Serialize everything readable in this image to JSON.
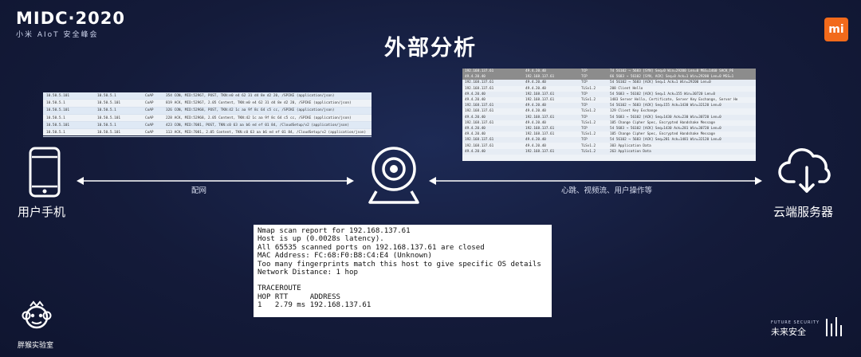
{
  "header": {
    "brand_title": "MIDC·2020",
    "brand_subtitle": "小米 AIoT 安全峰会",
    "mi_logo": "mi",
    "slide_title": "外部分析"
  },
  "left_capture": {
    "rows": [
      {
        "src": "10.50.5.101",
        "dst": "10.50.5.1",
        "proto": "CoAP",
        "info": "354 CON, MID:52967, POST, TKN:e0 e4 62 31 d4 8e d2 20, /SPIKE (application/json)"
      },
      {
        "src": "10.50.5.1",
        "dst": "10.50.5.101",
        "proto": "CoAP",
        "info": "819 ACK, MID:52967, 2.05 Content, TKN:e0 e4 62 31 d4 8e d2 20, /SPIKE (application/json)"
      },
      {
        "src": "10.50.5.101",
        "dst": "10.50.5.1",
        "proto": "CoAP",
        "info": "326 CON, MID:52968, POST, TKN:42 1c aa 9f 8c 64 c5 cc, /SPIKE (application/json)"
      },
      {
        "src": "10.50.5.1",
        "dst": "10.50.5.101",
        "proto": "CoAP",
        "info": "228 ACK, MID:52968, 2.05 Content, TKN:42 1c aa 9f 8c 64 c5 cc, /SPIKE (application/json)"
      },
      {
        "src": "10.50.5.101",
        "dst": "10.50.5.1",
        "proto": "CoAP",
        "info": "423 CON, MID:7081, POST, TKN:c0 63 aa b6 ed ef 01 84, /CloudSetup/v2 (application/json)"
      },
      {
        "src": "10.50.5.1",
        "dst": "10.50.5.101",
        "proto": "CoAP",
        "info": "113 ACK, MID:7081, 2.05 Content, TKN:c0 63 aa b6 ed ef 01 84, /CloudSetup/v2 (application/json)"
      }
    ]
  },
  "right_capture": {
    "rows": [
      {
        "src": "192.168.137.61",
        "dst": "49.4.20.40",
        "proto": "TCP",
        "info": "74 56102 → 5683 [SYN] Seq=0 Win=29200 Len=0 MSS=1460 SACK_PE",
        "hl": true
      },
      {
        "src": "49.4.20.40",
        "dst": "192.168.137.61",
        "proto": "TCP",
        "info": "66 5683 → 56102 [SYN, ACK] Seq=0 Ack=1 Win=29200 Len=0 MSS=1",
        "hl": true
      },
      {
        "src": "192.168.137.61",
        "dst": "49.4.20.40",
        "proto": "TCP",
        "info": "54 56102 → 5683 [ACK] Seq=1 Ack=1 Win=29200 Len=0"
      },
      {
        "src": "192.168.137.61",
        "dst": "49.4.20.40",
        "proto": "TLSv1.2",
        "info": "208 Client Hello"
      },
      {
        "src": "49.4.20.40",
        "dst": "192.168.137.61",
        "proto": "TCP",
        "info": "54 5683 → 56102 [ACK] Seq=1 Ack=155 Win=30720 Len=0"
      },
      {
        "src": "49.4.20.40",
        "dst": "192.168.137.61",
        "proto": "TLSv1.2",
        "info": "1483 Server Hello, Certificate, Server Key Exchange, Server He"
      },
      {
        "src": "192.168.137.61",
        "dst": "49.4.20.40",
        "proto": "TCP",
        "info": "54 56102 → 5683 [ACK] Seq=155 Ack=1430 Win=32120 Len=0"
      },
      {
        "src": "192.168.137.61",
        "dst": "49.4.20.40",
        "proto": "TLSv1.2",
        "info": "129 Client Key Exchange"
      },
      {
        "src": "49.4.20.40",
        "dst": "192.168.137.61",
        "proto": "TCP",
        "info": "54 5683 → 56102 [ACK] Seq=1430 Ack=230 Win=30720 Len=0"
      },
      {
        "src": "192.168.137.61",
        "dst": "49.4.20.40",
        "proto": "TLSv1.2",
        "info": "105 Change Cipher Spec, Encrypted Handshake Message"
      },
      {
        "src": "49.4.20.40",
        "dst": "192.168.137.61",
        "proto": "TCP",
        "info": "54 5683 → 56102 [ACK] Seq=1430 Ack=281 Win=30720 Len=0"
      },
      {
        "src": "49.4.20.40",
        "dst": "192.168.137.61",
        "proto": "TLSv1.2",
        "info": "105 Change Cipher Spec, Encrypted Handshake Message"
      },
      {
        "src": "192.168.137.61",
        "dst": "49.4.20.40",
        "proto": "TCP",
        "info": "54 56102 → 5683 [ACK] Seq=281 Ack=1481 Win=32120 Len=0"
      },
      {
        "src": "192.168.137.61",
        "dst": "49.4.20.40",
        "proto": "TLSv1.2",
        "info": "303 Application Data"
      },
      {
        "src": "49.4.20.40",
        "dst": "192.168.137.61",
        "proto": "TLSv1.2",
        "info": "263 Application Data"
      }
    ]
  },
  "diagram": {
    "phone_label": "用户手机",
    "server_label": "云端服务器",
    "left_edge_label": "配网",
    "right_edge_label": "心跳、视频流、用户操作等"
  },
  "nmap": {
    "lines": [
      "Nmap scan report for 192.168.137.61",
      "Host is up (0.0028s latency).",
      "All 65535 scanned ports on 192.168.137.61 are closed",
      "MAC Address: FC:68:F0:B8:C4:E4 (Unknown)",
      "Too many fingerprints match this host to give specific OS details",
      "Network Distance: 1 hop",
      "",
      "TRACEROUTE",
      "HOP RTT     ADDRESS",
      "1   2.79 ms 192.168.137.61"
    ]
  },
  "footer": {
    "left_lab": "胖猴实验室",
    "right_brand": "未来安全",
    "right_small": "FUTURE SECURITY"
  },
  "colors": {
    "background": "#141b3a",
    "mi_orange": "#f26a1b",
    "highlight_row": "#8c8c8c"
  }
}
